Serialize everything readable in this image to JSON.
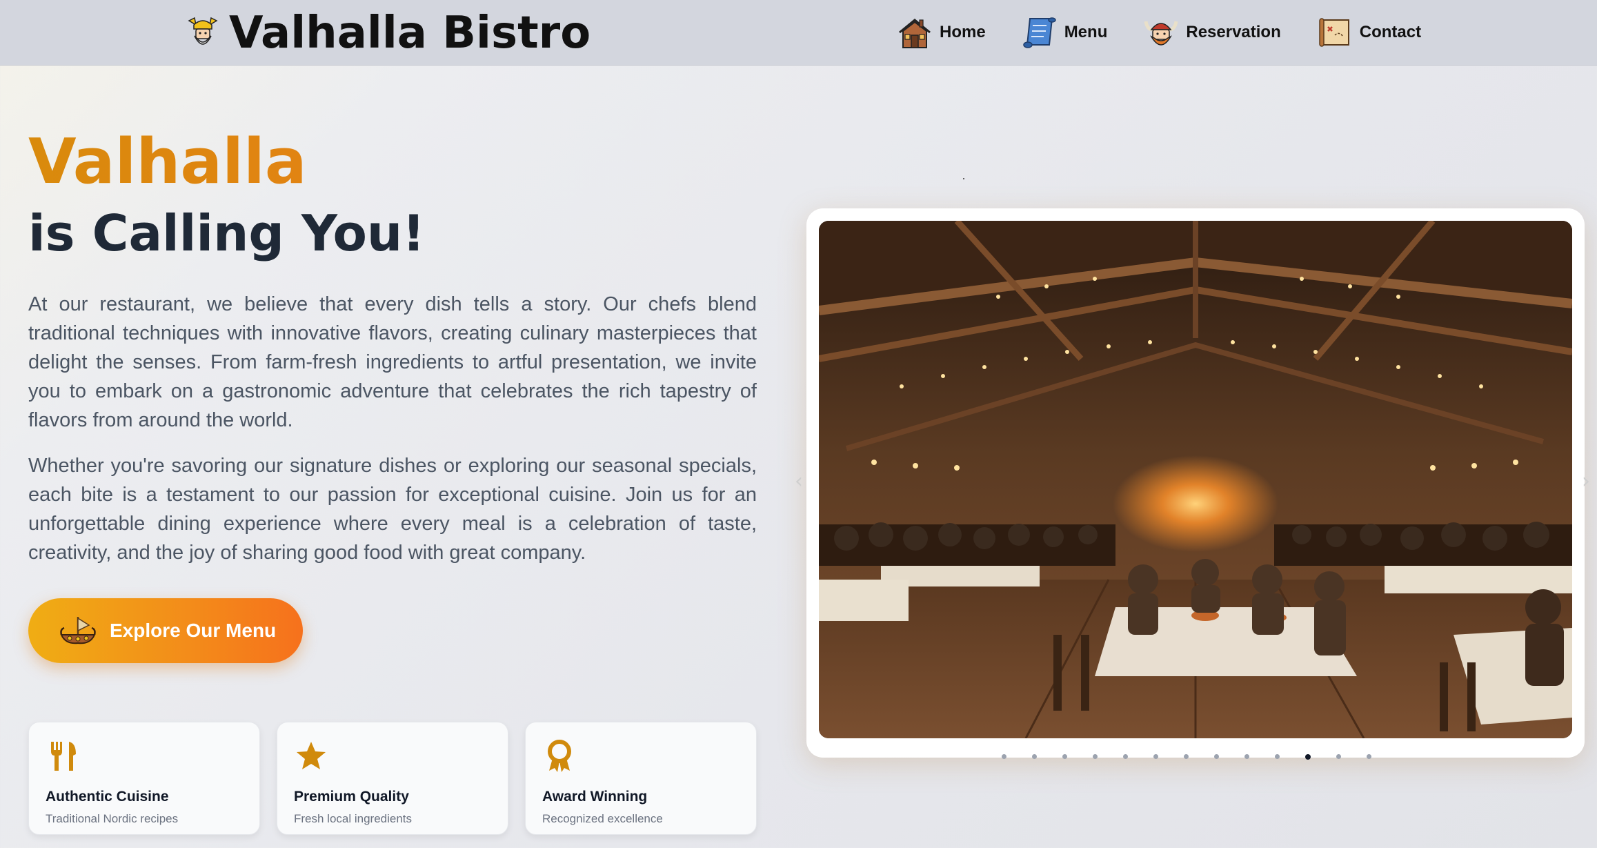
{
  "nav": {
    "brand": "Valhalla Bistro",
    "brand_icon": "viking-god-icon",
    "links": [
      {
        "label": "Home",
        "icon": "cabin-icon"
      },
      {
        "label": "Menu",
        "icon": "scroll-icon"
      },
      {
        "label": "Reservation",
        "icon": "viking-helmet-icon"
      },
      {
        "label": "Contact",
        "icon": "map-icon"
      }
    ]
  },
  "hero": {
    "title_accent": "Valhalla",
    "title_rest": "is Calling You!",
    "paragraph1": "At our restaurant, we believe that every dish tells a story. Our chefs blend traditional techniques with innovative flavors, creating culinary masterpieces that delight the senses. From farm-fresh ingredients to artful presentation, we invite you to embark on a gastronomic adventure that celebrates the rich tapestry of flavors from around the world.",
    "paragraph2": "Whether you're savoring our signature dishes or exploring our seasonal specials, each bite is a testament to our passion for exceptional cuisine. Join us for an unforgettable dining experience where every meal is a celebration of taste, creativity, and the joy of sharing good food with great company.",
    "cta_label": "Explore Our Menu",
    "cta_icon": "viking-ship-icon"
  },
  "features": [
    {
      "title": "Authentic Cuisine",
      "subtitle": "Traditional Nordic recipes",
      "icon": "utensils-icon"
    },
    {
      "title": "Premium Quality",
      "subtitle": "Fresh local ingredients",
      "icon": "star-icon"
    },
    {
      "title": "Award Winning",
      "subtitle": "Recognized excellence",
      "icon": "award-ribbon-icon"
    }
  ],
  "slider": {
    "image": "viking-mead-hall-feast",
    "slide_count": 13,
    "active_index": 10
  },
  "colors": {
    "accent_gold": "#dd8a12",
    "accent_orange": "#f6711c",
    "nav_bg": "#d3d6de",
    "icon_gold": "#d08a0c"
  }
}
